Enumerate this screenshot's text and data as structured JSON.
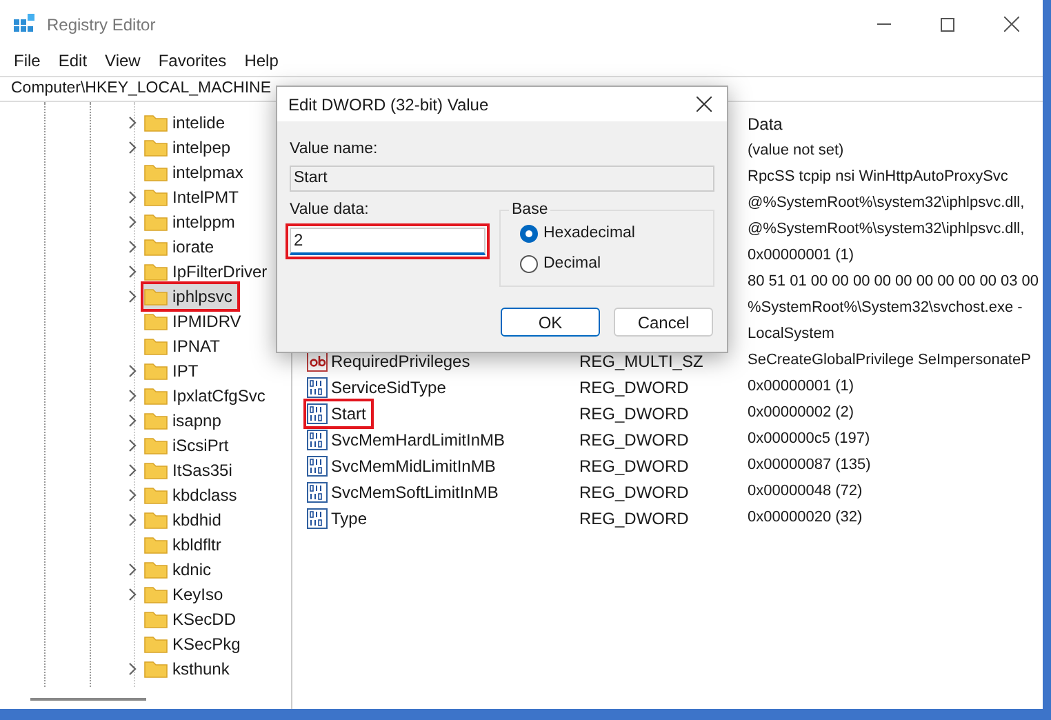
{
  "window": {
    "title": "Registry Editor"
  },
  "menu": [
    "File",
    "Edit",
    "View",
    "Favorites",
    "Help"
  ],
  "address": "Computer\\HKEY_LOCAL_MACHINE",
  "tree": [
    {
      "label": "intelide",
      "expandable": true,
      "selected": false
    },
    {
      "label": "intelpep",
      "expandable": true,
      "selected": false
    },
    {
      "label": "intelpmax",
      "expandable": false,
      "selected": false
    },
    {
      "label": "IntelPMT",
      "expandable": true,
      "selected": false
    },
    {
      "label": "intelppm",
      "expandable": true,
      "selected": false
    },
    {
      "label": "iorate",
      "expandable": true,
      "selected": false
    },
    {
      "label": "IpFilterDriver",
      "expandable": true,
      "selected": false
    },
    {
      "label": "iphlpsvc",
      "expandable": true,
      "selected": true,
      "marked": true
    },
    {
      "label": "IPMIDRV",
      "expandable": false,
      "selected": false
    },
    {
      "label": "IPNAT",
      "expandable": false,
      "selected": false
    },
    {
      "label": "IPT",
      "expandable": true,
      "selected": false
    },
    {
      "label": "IpxlatCfgSvc",
      "expandable": true,
      "selected": false
    },
    {
      "label": "isapnp",
      "expandable": true,
      "selected": false
    },
    {
      "label": "iScsiPrt",
      "expandable": true,
      "selected": false
    },
    {
      "label": "ItSas35i",
      "expandable": true,
      "selected": false
    },
    {
      "label": "kbdclass",
      "expandable": true,
      "selected": false
    },
    {
      "label": "kbdhid",
      "expandable": true,
      "selected": false
    },
    {
      "label": "kbldfltr",
      "expandable": false,
      "selected": false
    },
    {
      "label": "kdnic",
      "expandable": true,
      "selected": false
    },
    {
      "label": "KeyIso",
      "expandable": true,
      "selected": false
    },
    {
      "label": "KSecDD",
      "expandable": false,
      "selected": false
    },
    {
      "label": "KSecPkg",
      "expandable": false,
      "selected": false
    },
    {
      "label": "ksthunk",
      "expandable": true,
      "selected": false
    }
  ],
  "table": {
    "columns": [
      "Data"
    ],
    "rows": [
      {
        "data": "(value not set)"
      },
      {
        "data": "RpcSS tcpip nsi WinHttpAutoProxySvc"
      },
      {
        "data": "@%SystemRoot%\\system32\\iphlpsvc.dll,"
      },
      {
        "data": "@%SystemRoot%\\system32\\iphlpsvc.dll,"
      },
      {
        "data": "0x00000001 (1)"
      },
      {
        "data": "80 51 01 00 00 00 00 00 00 00 00 00 03 00"
      },
      {
        "data": "%SystemRoot%\\System32\\svchost.exe -"
      },
      {
        "data": "LocalSystem"
      },
      {
        "kind": "string",
        "name": "RequiredPrivileges",
        "type": "REG_MULTI_SZ",
        "data": "SeCreateGlobalPrivilege SeImpersonateP"
      },
      {
        "kind": "dword",
        "name": "ServiceSidType",
        "type": "REG_DWORD",
        "data": "0x00000001 (1)"
      },
      {
        "kind": "dword",
        "name": "Start",
        "type": "REG_DWORD",
        "data": "0x00000002 (2)",
        "marked": true
      },
      {
        "kind": "dword",
        "name": "SvcMemHardLimitInMB",
        "type": "REG_DWORD",
        "data": "0x000000c5 (197)"
      },
      {
        "kind": "dword",
        "name": "SvcMemMidLimitInMB",
        "type": "REG_DWORD",
        "data": "0x00000087 (135)"
      },
      {
        "kind": "dword",
        "name": "SvcMemSoftLimitInMB",
        "type": "REG_DWORD",
        "data": "0x00000048 (72)"
      },
      {
        "kind": "dword",
        "name": "Type",
        "type": "REG_DWORD",
        "data": "0x00000020 (32)"
      }
    ]
  },
  "dialog": {
    "title": "Edit DWORD (32-bit) Value",
    "name_label": "Value name:",
    "name_value": "Start",
    "data_label": "Value data:",
    "data_value": "2",
    "data_marked": true,
    "base_label": "Base",
    "bases": [
      {
        "label": "Hexadecimal",
        "selected": true
      },
      {
        "label": "Decimal",
        "selected": false
      }
    ],
    "buttons": [
      {
        "label": "OK",
        "default": true
      },
      {
        "label": "Cancel",
        "default": false
      }
    ]
  }
}
